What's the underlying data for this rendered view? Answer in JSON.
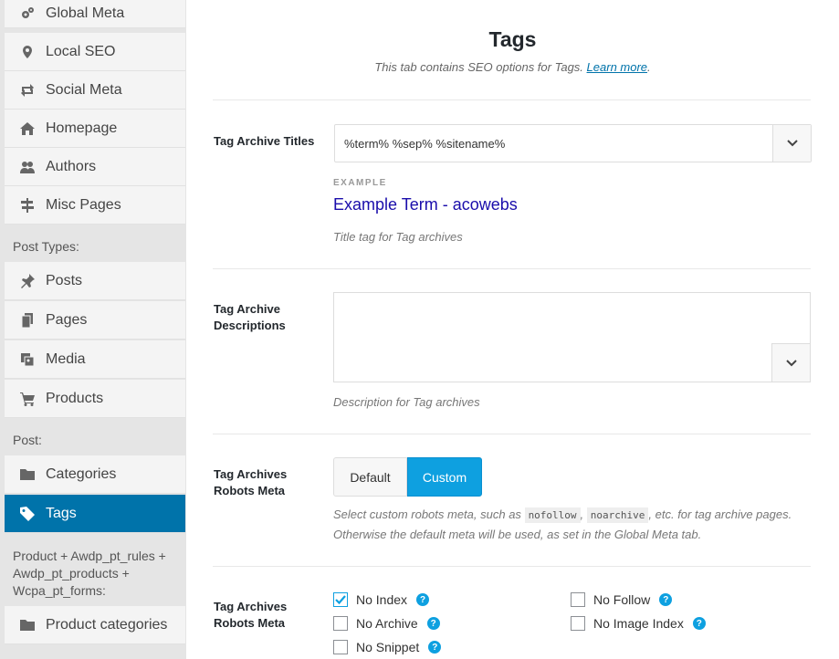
{
  "sidebar": {
    "items_top": [
      {
        "label": "Global Meta",
        "icon": "gears-icon"
      },
      {
        "label": "Local SEO",
        "icon": "map-pin-icon"
      },
      {
        "label": "Social Meta",
        "icon": "share-icon"
      },
      {
        "label": "Homepage",
        "icon": "home-icon"
      },
      {
        "label": "Authors",
        "icon": "users-icon"
      },
      {
        "label": "Misc Pages",
        "icon": "signpost-icon"
      }
    ],
    "post_types_heading": "Post Types:",
    "post_types": [
      {
        "label": "Posts",
        "icon": "pin-icon"
      },
      {
        "label": "Pages",
        "icon": "pages-icon"
      },
      {
        "label": "Media",
        "icon": "media-icon"
      },
      {
        "label": "Products",
        "icon": "cart-icon"
      }
    ],
    "post_heading": "Post:",
    "post_items": [
      {
        "label": "Categories",
        "icon": "folder-icon"
      },
      {
        "label": "Tags",
        "icon": "tag-icon",
        "active": true
      }
    ],
    "product_heading": "Product + Awdp_pt_rules + Awdp_pt_products + Wcpa_pt_forms:",
    "product_items": [
      {
        "label": "Product categories",
        "icon": "folder-icon"
      }
    ]
  },
  "main": {
    "title": "Tags",
    "subtitle": "This tab contains SEO options for Tags.",
    "learn_more": "Learn more",
    "period": ".",
    "titles": {
      "label": "Tag Archive Titles",
      "value": "%term% %sep% %sitename%",
      "example_caption": "EXAMPLE",
      "example_value": "Example Term - acowebs",
      "description": "Title tag for Tag archives"
    },
    "descriptions": {
      "label": "Tag Archive Descriptions",
      "value": "",
      "description": "Description for Tag archives"
    },
    "robots_toggle": {
      "label": "Tag Archives Robots Meta",
      "options": [
        "Default",
        "Custom"
      ],
      "selected": "Custom",
      "desc_1": "Select custom robots meta, such as",
      "code_1": "nofollow",
      "comma": ",",
      "code_2": "noarchive",
      "desc_2": ", etc. for tag archive pages. Otherwise the default meta will be used, as set in the Global Meta tab."
    },
    "robots_checks": {
      "label": "Tag Archives Robots Meta",
      "items": [
        {
          "label": "No Index",
          "checked": true
        },
        {
          "label": "No Follow",
          "checked": false
        },
        {
          "label": "No Archive",
          "checked": false
        },
        {
          "label": "No Image Index",
          "checked": false
        },
        {
          "label": "No Snippet",
          "checked": false
        }
      ],
      "help_glyph": "?"
    }
  },
  "colors": {
    "accent": "#0073aa",
    "toggle_active": "#0ea0e0",
    "example_link": "#1a0dab"
  }
}
